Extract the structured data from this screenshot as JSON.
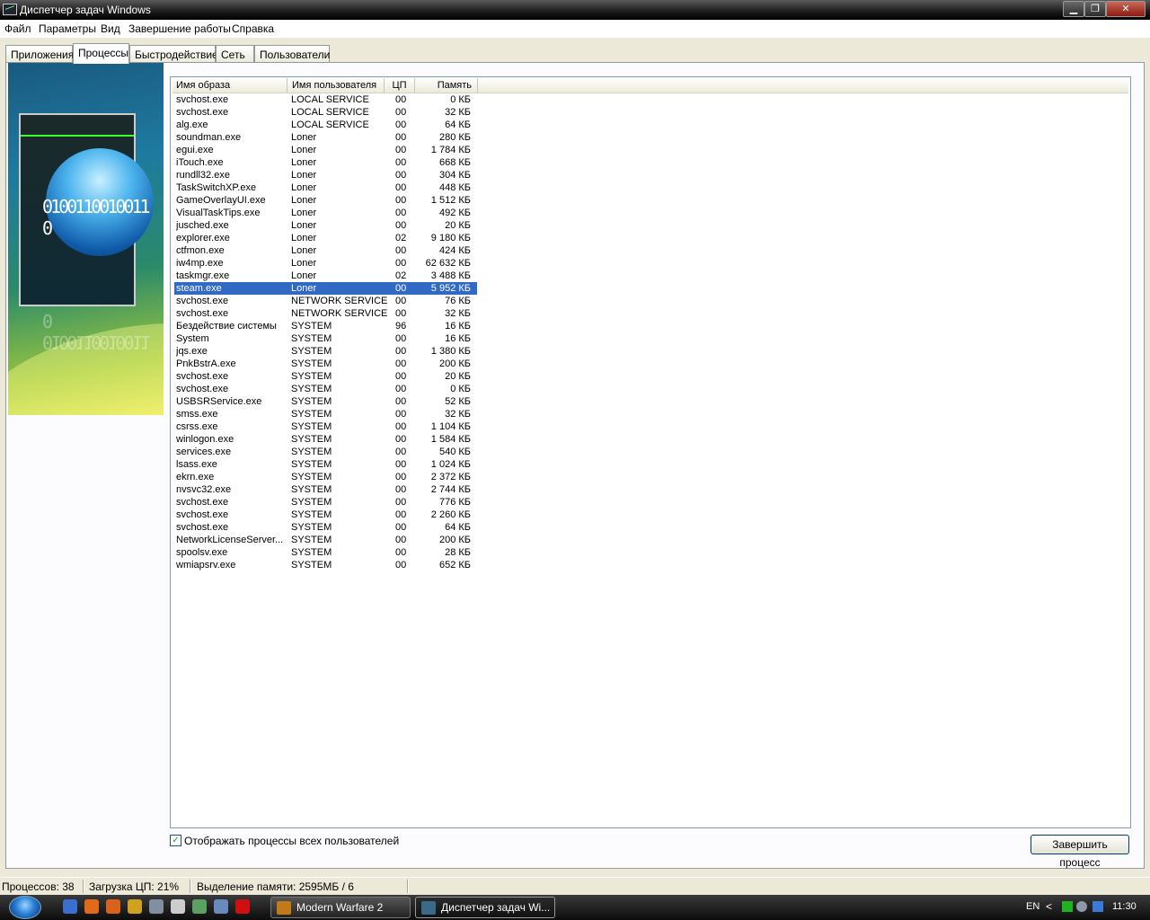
{
  "window": {
    "title": "Диспетчер задач Windows",
    "controls": {
      "minimize": "▁",
      "maximize": "❐",
      "close": "✕"
    }
  },
  "menu": [
    "Файл",
    "Параметры",
    "Вид",
    "Завершение работы",
    "Справка"
  ],
  "tabs": [
    {
      "label": "Приложения",
      "active": false
    },
    {
      "label": "Процессы",
      "active": true
    },
    {
      "label": "Быстродействие",
      "active": false
    },
    {
      "label": "Сеть",
      "active": false
    },
    {
      "label": "Пользователи",
      "active": false
    }
  ],
  "decor": {
    "bits_text": "0100110010011 0"
  },
  "columns": {
    "name": "Имя образа",
    "user": "Имя пользователя",
    "cpu": "ЦП",
    "mem": "Память"
  },
  "processes": [
    {
      "name": "svchost.exe",
      "user": "LOCAL SERVICE",
      "cpu": "00",
      "mem": "0 КБ"
    },
    {
      "name": "svchost.exe",
      "user": "LOCAL SERVICE",
      "cpu": "00",
      "mem": "32 КБ"
    },
    {
      "name": "alg.exe",
      "user": "LOCAL SERVICE",
      "cpu": "00",
      "mem": "64 КБ"
    },
    {
      "name": "soundman.exe",
      "user": "Loner",
      "cpu": "00",
      "mem": "280 КБ"
    },
    {
      "name": "egui.exe",
      "user": "Loner",
      "cpu": "00",
      "mem": "1 784 КБ"
    },
    {
      "name": "iTouch.exe",
      "user": "Loner",
      "cpu": "00",
      "mem": "668 КБ"
    },
    {
      "name": "rundll32.exe",
      "user": "Loner",
      "cpu": "00",
      "mem": "304 КБ"
    },
    {
      "name": "TaskSwitchXP.exe",
      "user": "Loner",
      "cpu": "00",
      "mem": "448 КБ"
    },
    {
      "name": "GameOverlayUI.exe",
      "user": "Loner",
      "cpu": "00",
      "mem": "1 512 КБ"
    },
    {
      "name": "VisualTaskTips.exe",
      "user": "Loner",
      "cpu": "00",
      "mem": "492 КБ"
    },
    {
      "name": "jusched.exe",
      "user": "Loner",
      "cpu": "00",
      "mem": "20 КБ"
    },
    {
      "name": "explorer.exe",
      "user": "Loner",
      "cpu": "02",
      "mem": "9 180 КБ"
    },
    {
      "name": "ctfmon.exe",
      "user": "Loner",
      "cpu": "00",
      "mem": "424 КБ"
    },
    {
      "name": "iw4mp.exe",
      "user": "Loner",
      "cpu": "00",
      "mem": "62 632 КБ"
    },
    {
      "name": "taskmgr.exe",
      "user": "Loner",
      "cpu": "02",
      "mem": "3 488 КБ"
    },
    {
      "name": "steam.exe",
      "user": "Loner",
      "cpu": "00",
      "mem": "5 952 КБ",
      "selected": true
    },
    {
      "name": "svchost.exe",
      "user": "NETWORK SERVICE",
      "cpu": "00",
      "mem": "76 КБ"
    },
    {
      "name": "svchost.exe",
      "user": "NETWORK SERVICE",
      "cpu": "00",
      "mem": "32 КБ"
    },
    {
      "name": "Бездействие системы",
      "user": "SYSTEM",
      "cpu": "96",
      "mem": "16 КБ"
    },
    {
      "name": "System",
      "user": "SYSTEM",
      "cpu": "00",
      "mem": "16 КБ"
    },
    {
      "name": "jqs.exe",
      "user": "SYSTEM",
      "cpu": "00",
      "mem": "1 380 КБ"
    },
    {
      "name": "PnkBstrA.exe",
      "user": "SYSTEM",
      "cpu": "00",
      "mem": "200 КБ"
    },
    {
      "name": "svchost.exe",
      "user": "SYSTEM",
      "cpu": "00",
      "mem": "20 КБ"
    },
    {
      "name": "svchost.exe",
      "user": "SYSTEM",
      "cpu": "00",
      "mem": "0 КБ"
    },
    {
      "name": "USBSRService.exe",
      "user": "SYSTEM",
      "cpu": "00",
      "mem": "52 КБ"
    },
    {
      "name": "smss.exe",
      "user": "SYSTEM",
      "cpu": "00",
      "mem": "32 КБ"
    },
    {
      "name": "csrss.exe",
      "user": "SYSTEM",
      "cpu": "00",
      "mem": "1 104 КБ"
    },
    {
      "name": "winlogon.exe",
      "user": "SYSTEM",
      "cpu": "00",
      "mem": "1 584 КБ"
    },
    {
      "name": "services.exe",
      "user": "SYSTEM",
      "cpu": "00",
      "mem": "540 КБ"
    },
    {
      "name": "lsass.exe",
      "user": "SYSTEM",
      "cpu": "00",
      "mem": "1 024 КБ"
    },
    {
      "name": "ekrn.exe",
      "user": "SYSTEM",
      "cpu": "00",
      "mem": "2 372 КБ"
    },
    {
      "name": "nvsvc32.exe",
      "user": "SYSTEM",
      "cpu": "00",
      "mem": "2 744 КБ"
    },
    {
      "name": "svchost.exe",
      "user": "SYSTEM",
      "cpu": "00",
      "mem": "776 КБ"
    },
    {
      "name": "svchost.exe",
      "user": "SYSTEM",
      "cpu": "00",
      "mem": "2 260 КБ"
    },
    {
      "name": "svchost.exe",
      "user": "SYSTEM",
      "cpu": "00",
      "mem": "64 КБ"
    },
    {
      "name": "NetworkLicenseServer...",
      "user": "SYSTEM",
      "cpu": "00",
      "mem": "200 КБ"
    },
    {
      "name": "spoolsv.exe",
      "user": "SYSTEM",
      "cpu": "00",
      "mem": "28 КБ"
    },
    {
      "name": "wmiapsrv.exe",
      "user": "SYSTEM",
      "cpu": "00",
      "mem": "652 КБ"
    }
  ],
  "show_all": {
    "label": "Отображать процессы всех пользователей",
    "checked": true,
    "mark": "✓"
  },
  "end_process_label": "Завершить процесс",
  "status": {
    "processes": "Процессов: 38",
    "cpu": "Загрузка ЦП: 21%",
    "memory": "Выделение памяти: 2595МБ / 6"
  },
  "taskbar": {
    "tasks": [
      {
        "label": "Modern Warfare 2",
        "icon": "mw2-icon",
        "color": "#c07a1a"
      },
      {
        "label": "Диспетчер задач Wi...",
        "icon": "taskmgr-icon",
        "color": "#3a6a8a"
      }
    ],
    "quicklaunch": [
      {
        "icon": "show-desktop-icon",
        "color": "#3a6fd0"
      },
      {
        "icon": "firefox-icon",
        "color": "#e06a1a"
      },
      {
        "icon": "media-player-icon",
        "color": "#d8621a"
      },
      {
        "icon": "eye-app-icon",
        "color": "#d0a020"
      },
      {
        "icon": "steam-icon",
        "color": "#8090a0"
      },
      {
        "icon": "clapper-icon",
        "color": "#cccccc"
      },
      {
        "icon": "network-icon",
        "color": "#5aa060"
      },
      {
        "icon": "calculator-icon",
        "color": "#6a8abf"
      },
      {
        "icon": "opera-icon",
        "color": "#d01010"
      }
    ],
    "tray": {
      "lang": "EN",
      "clock": "11:30",
      "arrow": "<"
    }
  }
}
